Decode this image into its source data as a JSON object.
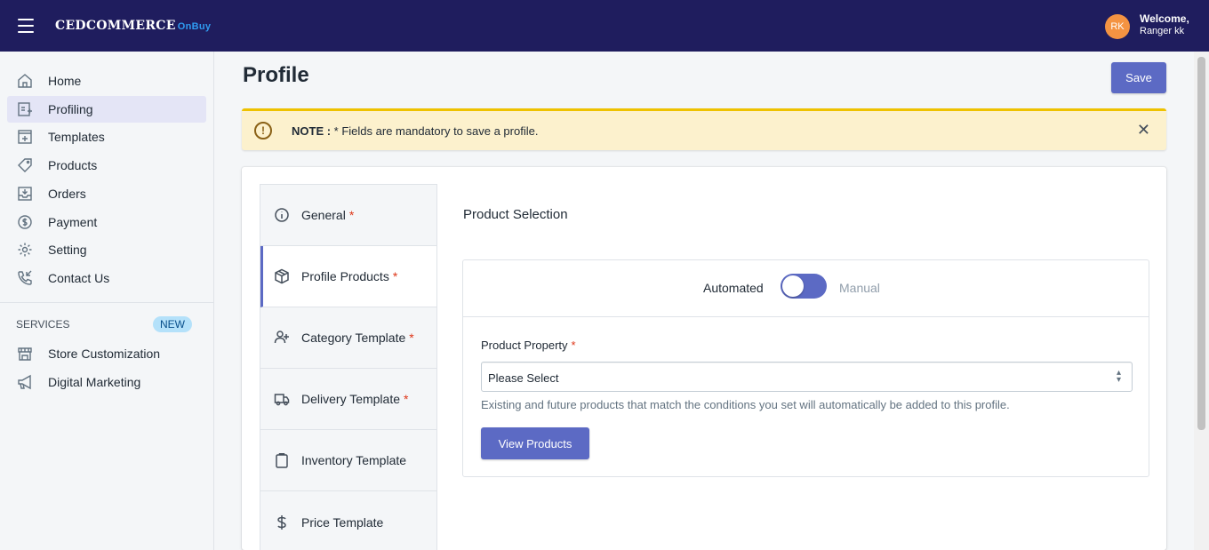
{
  "header": {
    "logo_text": "CEDCOMMERCE",
    "logo_suffix": "OnBuy",
    "avatar_initials": "RK",
    "welcome": "Welcome,",
    "user_name": "Ranger kk"
  },
  "sidebar": {
    "items": [
      {
        "label": "Home",
        "icon": "home-icon"
      },
      {
        "label": "Profiling",
        "icon": "profiling-icon"
      },
      {
        "label": "Templates",
        "icon": "templates-icon"
      },
      {
        "label": "Products",
        "icon": "tag-icon"
      },
      {
        "label": "Orders",
        "icon": "orders-icon"
      },
      {
        "label": "Payment",
        "icon": "dollar-icon"
      },
      {
        "label": "Setting",
        "icon": "gear-icon"
      },
      {
        "label": "Contact Us",
        "icon": "phone-icon"
      }
    ],
    "services_label": "SERVICES",
    "new_badge": "NEW",
    "services": [
      {
        "label": "Store Customization",
        "icon": "store-icon"
      },
      {
        "label": "Digital Marketing",
        "icon": "megaphone-icon"
      }
    ]
  },
  "page": {
    "title": "Profile",
    "save_label": "Save"
  },
  "banner": {
    "note_label": "NOTE :",
    "message": " * Fields are mandatory to save a profile.",
    "close": "✕"
  },
  "tabs": [
    {
      "label": "General",
      "required": true
    },
    {
      "label": "Profile Products",
      "required": true
    },
    {
      "label": "Category Template",
      "required": true
    },
    {
      "label": "Delivery Template",
      "required": true
    },
    {
      "label": "Inventory Template",
      "required": false
    },
    {
      "label": "Price Template",
      "required": false
    }
  ],
  "product_selection": {
    "title": "Product Selection",
    "automated_label": "Automated",
    "manual_label": "Manual",
    "property_label": "Product Property",
    "required_mark": "*",
    "select_value": "Please Select",
    "help_text": "Existing and future products that match the conditions you set will automatically be added to this profile.",
    "view_button": "View Products"
  },
  "colors": {
    "topbar": "#1f1d5e",
    "accent": "#5c6ac4",
    "banner_bg": "#fcf1cd",
    "avatar": "#f49342"
  }
}
